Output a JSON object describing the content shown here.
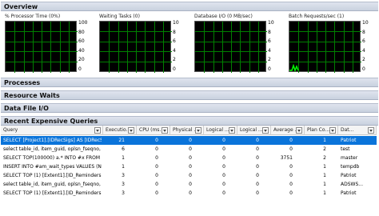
{
  "sections": {
    "overview": "Overview",
    "processes": "Processes",
    "resource_waits": "Resource Waits",
    "data_file_io": "Data File I/O",
    "recent_queries": "Recent Expensive Queries"
  },
  "charts": [
    {
      "label": "% Processor Time (0%)",
      "ticks": [
        "100",
        "80",
        "60",
        "40",
        "20",
        "0"
      ]
    },
    {
      "label": "Waiting Tasks (0)",
      "ticks": [
        "10",
        "8",
        "6",
        "4",
        "2",
        "0"
      ]
    },
    {
      "label": "Database I/O (0 MB/sec)",
      "ticks": [
        "10",
        "8",
        "6",
        "4",
        "2",
        "0"
      ]
    },
    {
      "label": "Batch Requests/sec (1)",
      "ticks": [
        "10",
        "8",
        "6",
        "4",
        "2",
        "0"
      ]
    }
  ],
  "chart_colors": {
    "grid": "#008000",
    "line": "#00ff00",
    "background": "#000000"
  },
  "columns": [
    "Query",
    "Executio...",
    "CPU (ms...",
    "Physical ...",
    "Logical ...",
    "Logical ...",
    "Average ...",
    "Plan Co...",
    "Dat..."
  ],
  "rows": [
    [
      "SELECT    [Project1].[IDRecSigs] AS [IDRecSi...",
      "21",
      "0",
      "0",
      "0",
      "0",
      "0",
      "1",
      "Patriot"
    ],
    [
      "select table_id, item_guid, oplsn_fseqno, oplsn...",
      "6",
      "0",
      "0",
      "0",
      "0",
      "0",
      "2",
      "test"
    ],
    [
      "SELECT TOP(100000)    a.* INTO #x FROM ...",
      "1",
      "0",
      "0",
      "0",
      "0",
      "3751",
      "2",
      "master"
    ],
    [
      "INSERT INTO #am_wait_types VALUES (N'Ba...",
      "1",
      "0",
      "0",
      "0",
      "0",
      "0",
      "1",
      "tempdb"
    ],
    [
      "SELECT TOP (1)    [Extent1].[ID_Reminders] A...",
      "3",
      "0",
      "0",
      "0",
      "0",
      "0",
      "1",
      "Patriot"
    ],
    [
      "select table_id, item_guid, oplsn_fseqno, oplsn...",
      "3",
      "0",
      "0",
      "0",
      "0",
      "0",
      "1",
      "ADSWS..."
    ],
    [
      "SELECT TOP (1)    [Extent1].[ID_Reminders] A...",
      "3",
      "0",
      "0",
      "0",
      "0",
      "0",
      "1",
      "Patriot"
    ]
  ]
}
